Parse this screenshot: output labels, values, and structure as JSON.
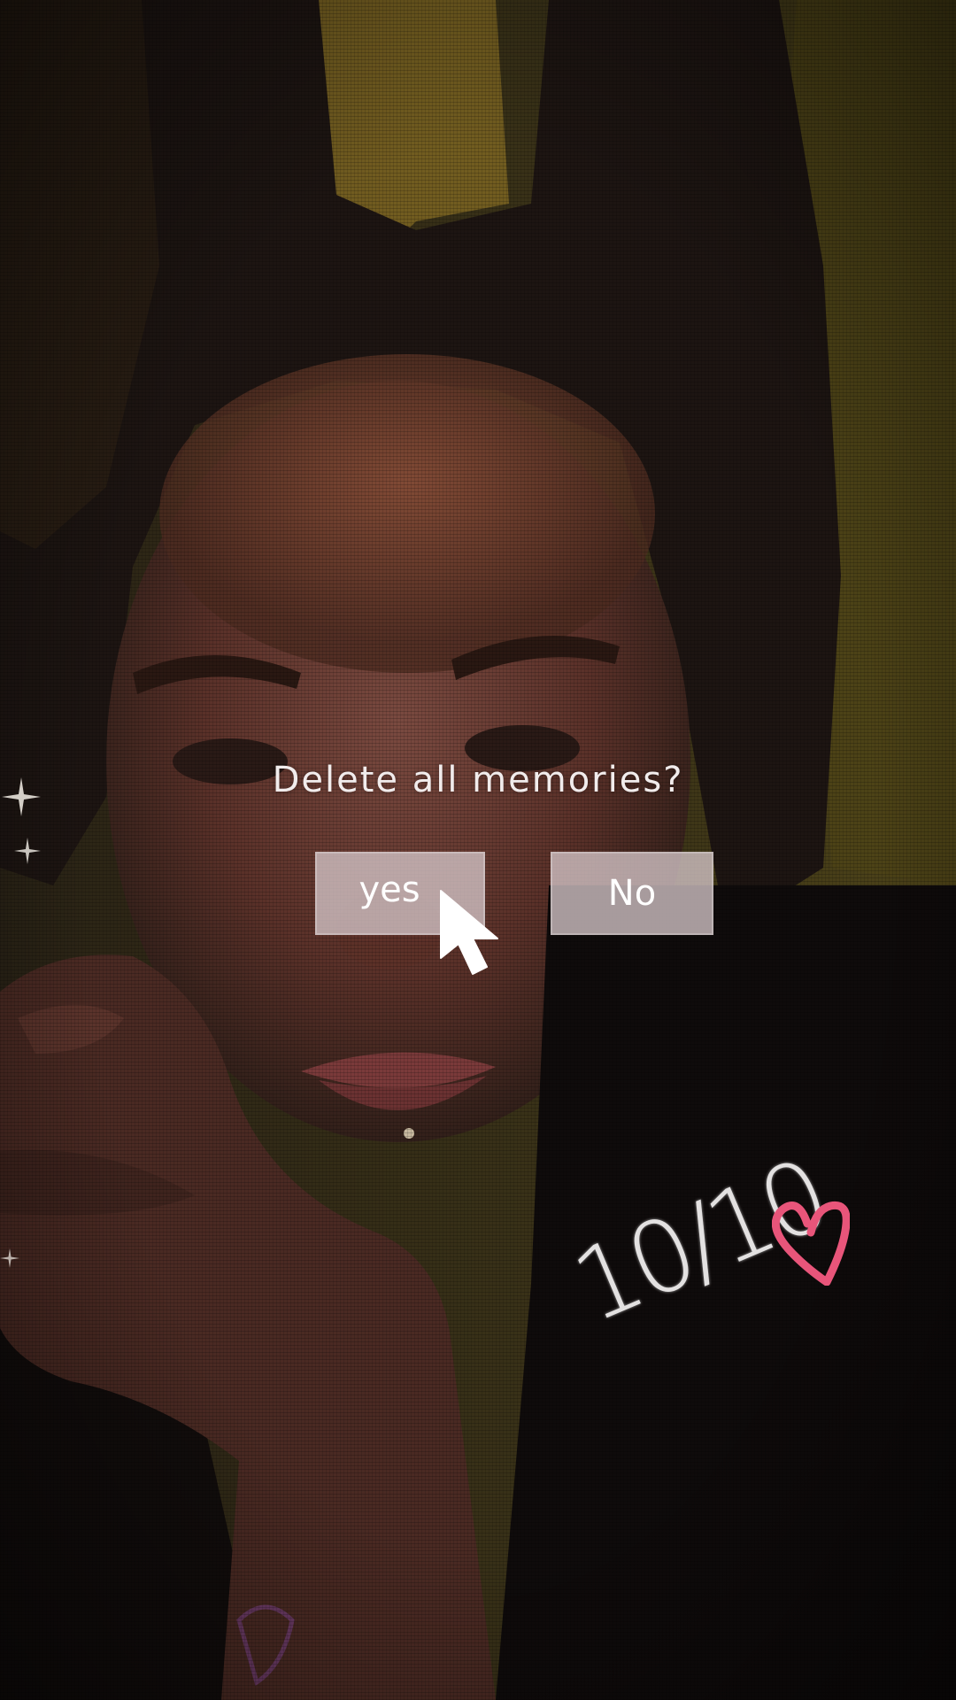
{
  "dialog": {
    "question": "Delete all memories?",
    "yes_label": "yes",
    "no_label": "No"
  },
  "sticker": {
    "score_text": "10/10"
  },
  "icons": {
    "cursor": "mouse-pointer-icon",
    "heart": "heart-doodle-icon",
    "sparkle": "sparkle-icon"
  },
  "colors": {
    "button_fill": "#d4c4c7",
    "text_light": "#f1ecec",
    "heart_pink": "#e8557a"
  }
}
